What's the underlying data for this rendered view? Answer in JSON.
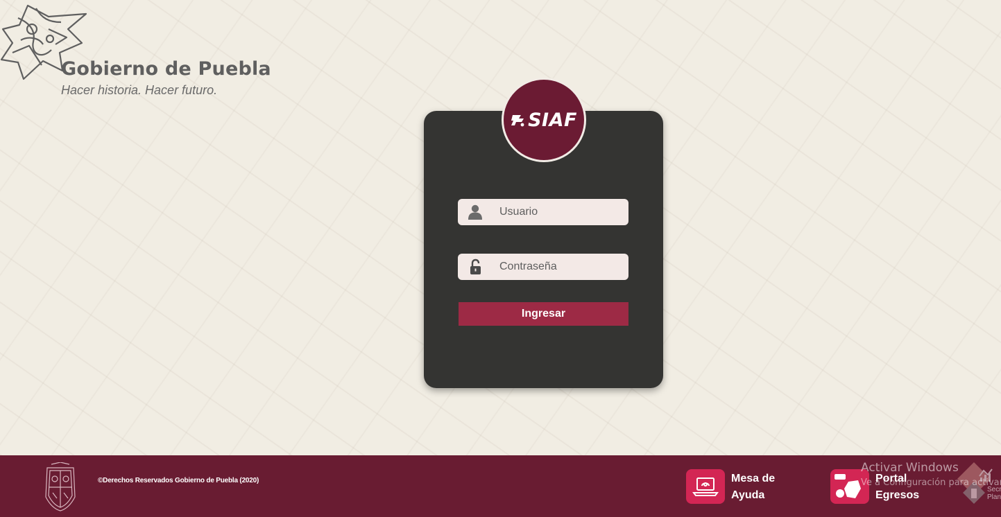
{
  "header": {
    "title": "Gobierno de Puebla",
    "slogan": "Hacer historia. Hacer futuro."
  },
  "login": {
    "brand": "SIAF",
    "username_placeholder": "Usuario",
    "password_placeholder": "Contraseña",
    "submit_label": "Ingresar"
  },
  "footer": {
    "copyright": "©Derechos Reservados Gobierno de Puebla (2020)",
    "links": [
      {
        "line1": "Mesa de",
        "line2": "Ayuda",
        "icon": "helpdesk-laptop-icon"
      },
      {
        "line1": "Portal",
        "line2": "Egresos",
        "icon": "portal-egresos-icon"
      }
    ],
    "watermark_title": "Activar Windows",
    "watermark_subtitle": "Ve a Configuración para activar Windows.",
    "seplan_text": [
      "Secr",
      "Plan"
    ]
  },
  "colors": {
    "background": "#f1ede3",
    "card": "#343432",
    "brand_maroon": "#691c32",
    "button": "#9d2a45",
    "footer_tile": "#d32654"
  }
}
